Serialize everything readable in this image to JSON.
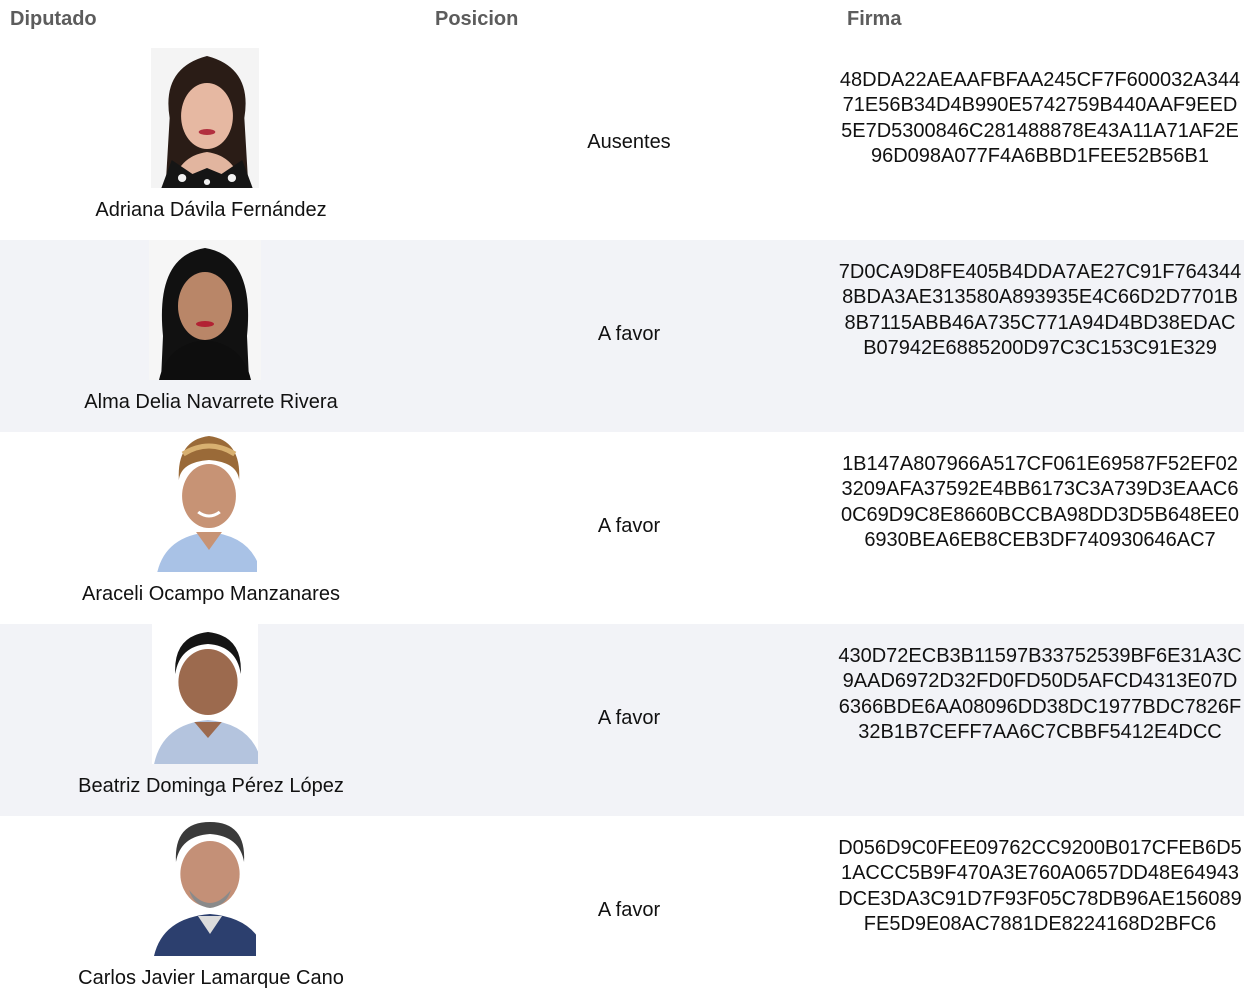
{
  "headers": {
    "diputado": "Diputado",
    "posicion": "Posicion",
    "firma": "Firma"
  },
  "rows": [
    {
      "name": "Adriana Dávila Fernández",
      "position": "Ausentes",
      "firma": "48DDA22AEAAFBFAA245CF7F600032A34471E56B34D4B990E5742759B440AAF9EED5E7D5300846C281488878E43A11A71AF2E96D098A077F4A6BBD1FEE52B56B1"
    },
    {
      "name": "Alma Delia Navarrete Rivera",
      "position": "A favor",
      "firma": "7D0CA9D8FE405B4DDA7AE27C91F7643448BDA3AE313580A893935E4C66D2D7701B8B7115ABB46A735C771A94D4BD38EDACB07942E6885200D97C3C153C91E329"
    },
    {
      "name": "Araceli Ocampo Manzanares",
      "position": "A favor",
      "firma": "1B147A807966A517CF061E69587F52EF023209AFA37592E4BB6173C3A739D3EAAC60C69D9C8E8660BCCBA98DD3D5B648EE06930BEA6EB8CEB3DF740930646AC7"
    },
    {
      "name": "Beatriz Dominga Pérez López",
      "position": "A favor",
      "firma": "430D72ECB3B11597B33752539BF6E31A3C9AAD6972D32FD0FD50D5AFCD4313E07D6366BDE6AA08096DD38DC1977BDC7826F32B1B7CEFF7AA6C7CBBF5412E4DCC"
    },
    {
      "name": "Carlos Javier Lamarque Cano",
      "position": "A favor",
      "firma": "D056D9C0FEE09762CC9200B017CFEB6D51ACCC5B9F470A3E760A0657DD48E64943DCE3DA3C91D7F93F05C78DB96AE156089FE5D9E08AC7881DE8224168D2BFC6"
    }
  ],
  "colors": {
    "alt_row_bg": "#f2f3f7",
    "header_text": "#5c5c5c"
  }
}
